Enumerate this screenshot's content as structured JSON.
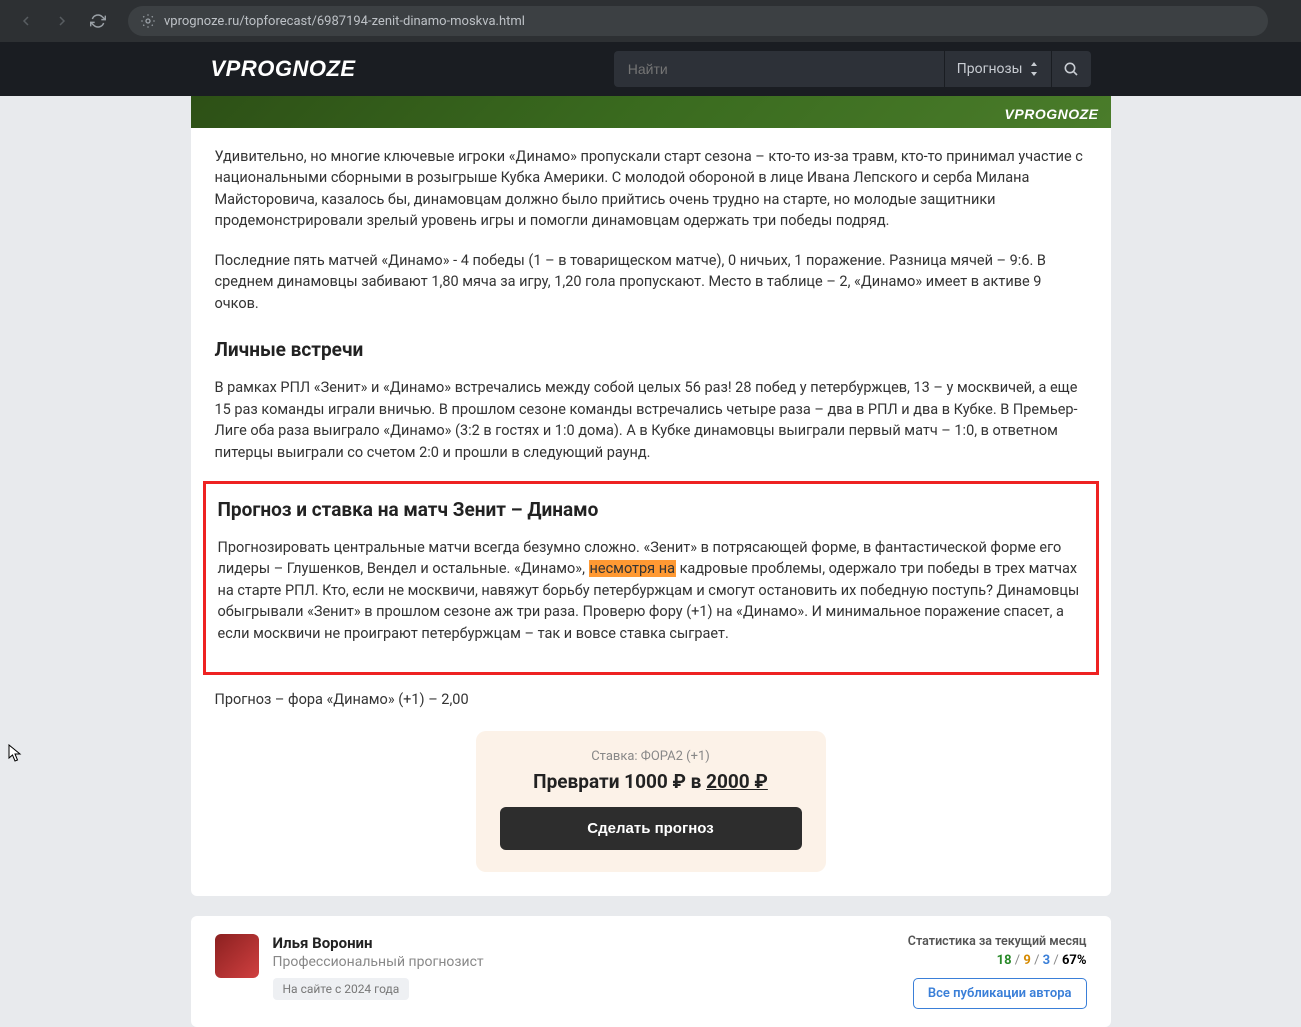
{
  "browser": {
    "url": "vprognoze.ru/topforecast/6987194-zenit-dinamo-moskva.html"
  },
  "header": {
    "logo": "VPROGNOZE",
    "search_placeholder": "Найти",
    "filter_label": "Прогнозы"
  },
  "article": {
    "img_watermark": "VPROGNOZE",
    "p1": "Удивительно, но многие ключевые игроки «Динамо» пропускали старт сезона – кто-то из-за травм, кто-то принимал участие с национальными сборными в розыгрыше Кубка Америки. С молодой обороной в лице Ивана Лепского и серба Милана Майсторовича, казалось бы, динамовцам должно было прийтись очень трудно на старте, но молодые защитники продемонстрировали зрелый уровень игры и помогли динамовцам одержать три победы подряд.",
    "p2": "Последние пять матчей «Динамо» - 4 победы (1 – в товарищеском матче), 0 ничьих, 1 поражение. Разница мячей – 9:6. В среднем динамовцы забивают 1,80 мяча за игру, 1,20 гола пропускают. Место в таблице – 2, «Динамо» имеет в активе 9 очков.",
    "h1": "Личные встречи",
    "p3": "В рамках РПЛ «Зенит» и «Динамо» встречались между собой целых 56 раз! 28 побед у петербуржцев, 13 – у москвичей, а еще 15 раз команды играли вничью. В прошлом сезоне команды встречались четыре раза – два в РПЛ и два в Кубке. В Премьер-Лиге оба раза выиграло «Динамо» (3:2 в гостях и 1:0 дома). А в Кубке динамовцы выиграли первый матч – 1:0, в ответном питерцы выиграли со счетом 2:0 и прошли в следующий раунд.",
    "h2": "Прогноз и ставка на матч Зенит – Динамо",
    "p4a": "Прогнозировать центральные матчи всегда безумно сложно. «Зенит» в потрясающей форме, в фантастической форме его лидеры – Глушенков, Вендел и остальные. «Динамо», ",
    "p4hl": "несмотря на",
    "p4b": " кадровые проблемы, одержало три победы в трех матчах на старте РПЛ. Кто, если не москвичи, навяжут борьбу петербуржцам и смогут остановить их победную поступь? Динамовцы обыгрывали «Зенит» в прошлом сезоне аж три раза. Проверю фору (+1) на «Динамо». И минимальное поражение спасет, а если москвичи не проиграют петербуржцам – так и вовсе ставка сыграет.",
    "p5": "Прогноз – фора «Динамо» (+1) – 2,00"
  },
  "bet": {
    "label": "Ставка: ФОРА2 (+1)",
    "amount_pre": "Преврати 1000 ₽ в ",
    "amount_linked": "2000 ₽",
    "button": "Сделать прогноз"
  },
  "author": {
    "name": "Илья Воронин",
    "role": "Профессиональный прогнозист",
    "badge": "На сайте с 2024 года",
    "stats_label": "Статистика за текущий месяц",
    "s1": "18",
    "s2": "9",
    "s3": "3",
    "s4": "67%",
    "link": "Все публикации автора"
  }
}
